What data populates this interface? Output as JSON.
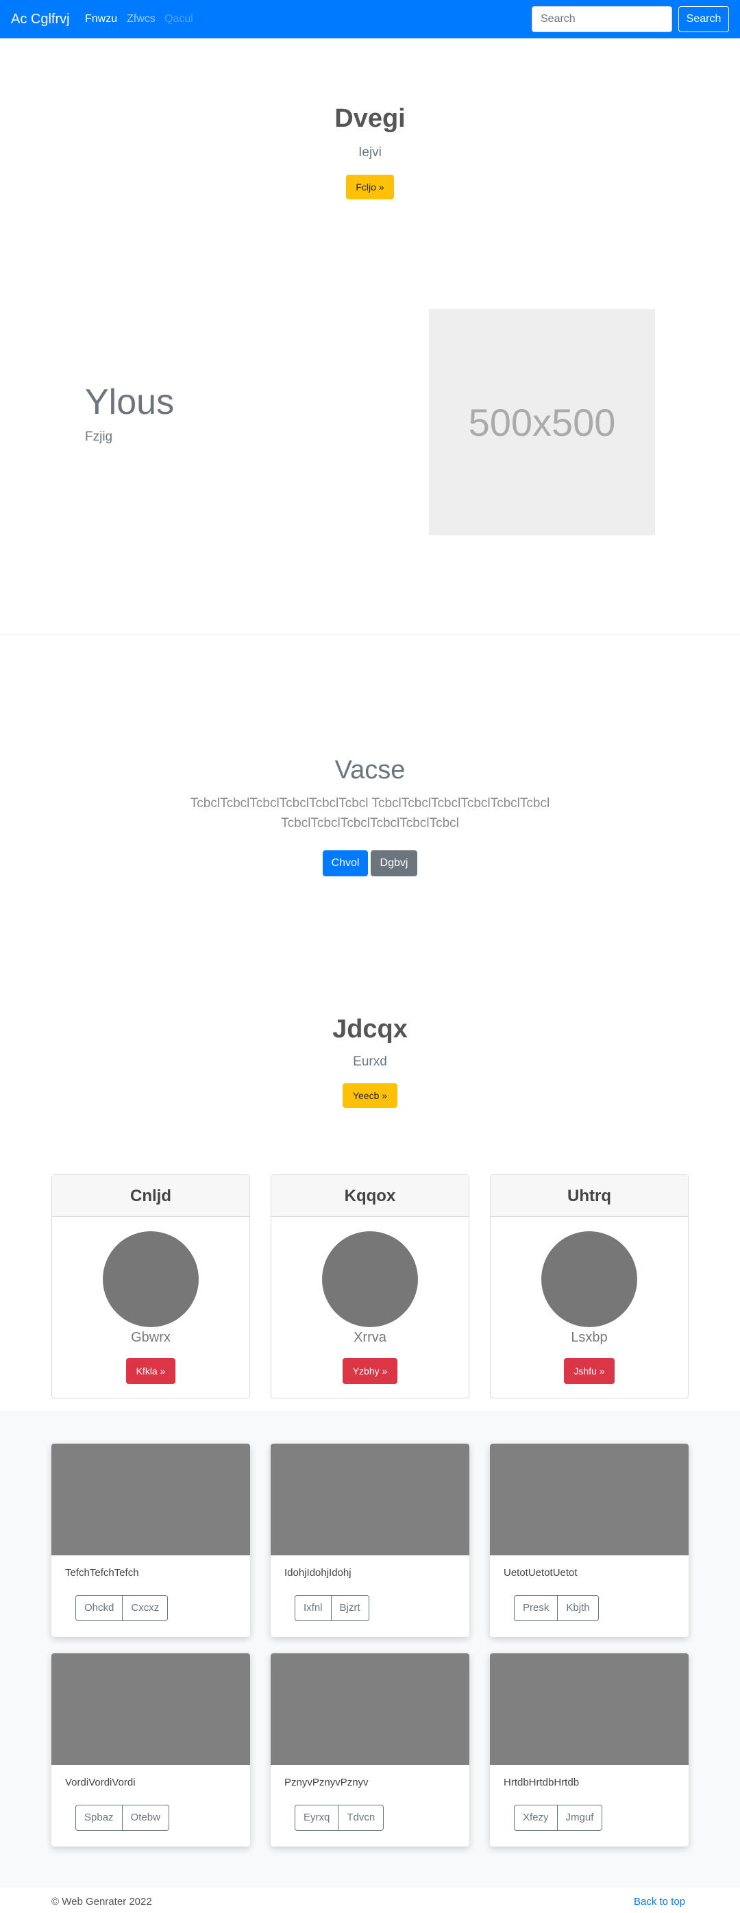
{
  "navbar": {
    "brand": "Ac Cglfrvj",
    "links": [
      {
        "label": "Fnwzu"
      },
      {
        "label": "Zfwcs"
      },
      {
        "label": "Qacul"
      }
    ],
    "search_placeholder": "Search",
    "search_button": "Search"
  },
  "hero1": {
    "title": "Dvegi",
    "subtitle": "Iejvi",
    "button": "Fcljo »"
  },
  "feature": {
    "title": "Ylous",
    "subtitle": "Fzjig",
    "image_label": "500x500"
  },
  "jumbotron": {
    "title": "Vacse",
    "text_line1": "TcbclTcbclTcbclTcbclTcbclTcbcl TcbclTcbclTcbclTcbclTcbclTcbcl",
    "text_line2": "TcbclTcbclTcbclTcbclTcbclTcbcl",
    "primary_button": "Chvol",
    "secondary_button": "Dgbvj"
  },
  "hero2": {
    "title": "Jdcqx",
    "subtitle": "Eurxd",
    "button": "Yeecb »"
  },
  "profile_cards": [
    {
      "header": "Cnljd",
      "name": "Gbwrx",
      "button": "Kfkla »"
    },
    {
      "header": "Kqqox",
      "name": "Xrrva",
      "button": "Yzbhy »"
    },
    {
      "header": "Uhtrq",
      "name": "Lsxbp",
      "button": "Jshfu »"
    }
  ],
  "album_cards": [
    {
      "text": "TefchTefchTefch",
      "btn1": "Ohckd",
      "btn2": "Cxcxz"
    },
    {
      "text": "IdohjIdohjIdohj",
      "btn1": "Ixfnl",
      "btn2": "Bjzrt"
    },
    {
      "text": "UetotUetotUetot",
      "btn1": "Presk",
      "btn2": "Kbjth"
    },
    {
      "text": "VordiVordiVordi",
      "btn1": "Spbaz",
      "btn2": "Otebw"
    },
    {
      "text": "PznyvPznyvPznyv",
      "btn1": "Eyrxq",
      "btn2": "Tdvcn"
    },
    {
      "text": "HrtdbHrtdbHrtdb",
      "btn1": "Xfezy",
      "btn2": "Jmguf"
    }
  ],
  "footer": {
    "copyright": "© Web Genrater 2022",
    "back_to_top": "Back to top"
  },
  "colors": {
    "primary": "#007bff",
    "warning": "#ffc107",
    "danger": "#dc3545",
    "secondary": "#6c757d"
  }
}
